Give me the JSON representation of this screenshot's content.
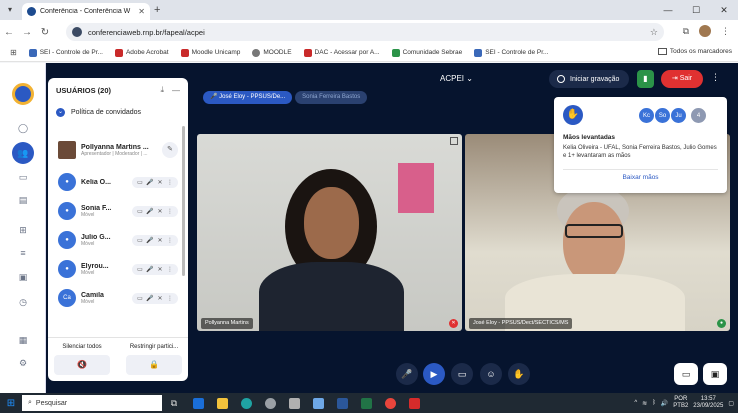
{
  "browser": {
    "tab_title": "Conferência - Conferência W",
    "url": "conferenciaweb.rnp.br/fapeal/acpei",
    "bookmarks": [
      "SEI - Controle de Pr...",
      "Adobe Acrobat",
      "Moodle Unicamp",
      "MOODLE",
      "DAC - Acessar por A...",
      "Comunidade Sebrae",
      "SEI - Controle de Pr..."
    ],
    "bookmarks_all": "Todos os marcadores"
  },
  "users_panel": {
    "title": "USUÁRIOS (20)",
    "policy_label": "Política de convidados",
    "users": [
      {
        "name": "Pollyanna Martins ...",
        "role": "Apresentador | Moderador | ...",
        "initials": ""
      },
      {
        "name": "Kelia O...",
        "role": "Móvel",
        "initials": ""
      },
      {
        "name": "Sonia F...",
        "role": "Móvel",
        "initials": ""
      },
      {
        "name": "Julio G...",
        "role": "Móvel",
        "initials": ""
      },
      {
        "name": "Elyrou...",
        "role": "Móvel",
        "initials": ""
      },
      {
        "name": "Camila",
        "role": "Móvel",
        "initials": "Ca"
      }
    ],
    "silence_all": "Silenciar todos",
    "restrict": "Restringir partici..."
  },
  "topbar": {
    "meeting_title": "ACPEI",
    "record_label": "Iniciar gravação",
    "leave_label": "Sair"
  },
  "talkers": [
    "José Eloy - PPSUS/De...",
    "Sonia Ferreira Bastos"
  ],
  "videos": [
    {
      "label": "Pollyanna Martins"
    },
    {
      "label": "José Eloy - PPSUS/Dect/SECTICS/MS"
    }
  ],
  "raised_hands": {
    "avatars": [
      "Kc",
      "So",
      "Ju",
      "4"
    ],
    "title": "Mãos levantadas",
    "text": "Kelia Oliveira - UFAL, Sonia Ferreira Bastos, Julio Gomes e 1+ levantaram as mãos",
    "lower_label": "Baixar mãos"
  },
  "taskbar": {
    "search_placeholder": "Pesquisar",
    "lang_top": "POR",
    "lang_bottom": "PTB2",
    "time": "13:57",
    "date": "23/09/2025"
  },
  "colors": {
    "accent": "#2b59c3",
    "leave": "#e03131",
    "app_bg": "#06142e"
  }
}
